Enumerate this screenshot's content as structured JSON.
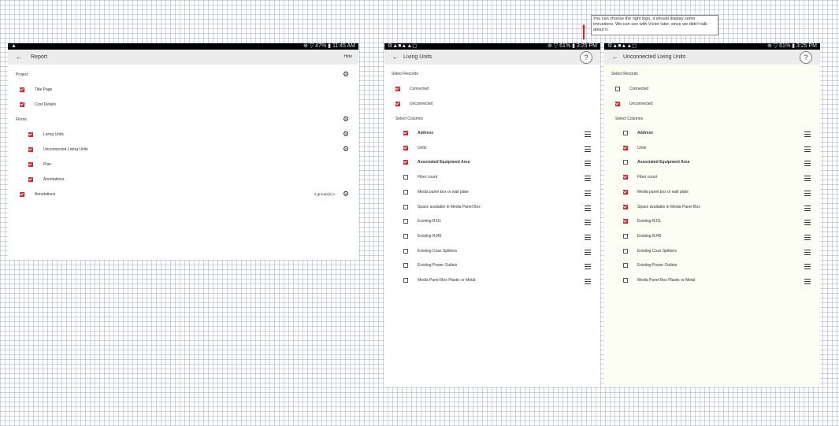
{
  "left_panel": {
    "status_time": "11:45 AM",
    "status_icons": "⊕ ▽ 47% ▮",
    "title": "Report",
    "action": "Hide",
    "items": [
      {
        "label": "Project",
        "checked": null,
        "gear": true
      },
      {
        "label": "Title Page",
        "checked": true,
        "gear": false
      },
      {
        "label": "Cost Details",
        "checked": true,
        "gear": false
      },
      {
        "label": "Floors",
        "checked": null,
        "gear": true
      },
      {
        "label": "Living Units",
        "checked": true,
        "gear": true
      },
      {
        "label": "Unconnected Living Units",
        "checked": true,
        "gear": true
      },
      {
        "label": "Plan",
        "checked": true,
        "gear": false
      },
      {
        "label": "Annotations",
        "checked": true,
        "gear": false
      },
      {
        "label": "Annotations",
        "checked": true,
        "gear": true,
        "extra": "3 groups(s) ▷"
      }
    ]
  },
  "middle_panel": {
    "status_time": "3:25 PM",
    "status_left": "⚙▲■▲▲◻",
    "status_icons": "⊕ ▽ 61% ▮",
    "title": "Living Units",
    "help": "?",
    "select_records_label": "Select Records",
    "records": [
      {
        "label": "Connected",
        "checked": true
      },
      {
        "label": "Unconnected",
        "checked": true
      }
    ],
    "select_columns_label": "Select Columns",
    "columns": [
      {
        "label": "Address",
        "checked": true,
        "bold": true
      },
      {
        "label": "Units",
        "checked": true,
        "bold": false
      },
      {
        "label": "Associated Equipment Area",
        "checked": true,
        "bold": true
      },
      {
        "label": "Fiber count",
        "checked": false,
        "bold": false
      },
      {
        "label": "Media panel box or wall plate",
        "checked": false,
        "bold": false
      },
      {
        "label": "Space available in Media Panel Box",
        "checked": false,
        "bold": false
      },
      {
        "label": "Existing RJ11",
        "checked": false,
        "bold": false
      },
      {
        "label": "Existing RJ45",
        "checked": false,
        "bold": false
      },
      {
        "label": "Existing Coax Splitters",
        "checked": false,
        "bold": false
      },
      {
        "label": "Existing Power Outlets",
        "checked": false,
        "bold": false
      },
      {
        "label": "Media Panel Box Plastic or Metal",
        "checked": false,
        "bold": false
      }
    ]
  },
  "right_panel": {
    "status_time": "3:25 PM",
    "status_left": "⚙▲■▲▲◻",
    "status_icons": "⊕ ▽ 61% ▮",
    "title": "Unconnected Living Units",
    "help": "?",
    "select_records_label": "Select Records",
    "records": [
      {
        "label": "Connected",
        "checked": false
      },
      {
        "label": "Unconnected",
        "checked": true
      }
    ],
    "select_columns_label": "Select Columns",
    "columns": [
      {
        "label": "Address",
        "checked": false,
        "bold": true
      },
      {
        "label": "Units",
        "checked": true,
        "bold": false
      },
      {
        "label": "Associated Equipment Area",
        "checked": false,
        "bold": true
      },
      {
        "label": "Fiber count",
        "checked": true,
        "bold": false
      },
      {
        "label": "Media panel box or wall plate",
        "checked": true,
        "bold": false
      },
      {
        "label": "Space available in Media Panel Box",
        "checked": true,
        "bold": false
      },
      {
        "label": "Existing RJ11",
        "checked": true,
        "bold": false
      },
      {
        "label": "Existing RJ45",
        "checked": false,
        "bold": false
      },
      {
        "label": "Existing Coax Splitters",
        "checked": false,
        "bold": false
      },
      {
        "label": "Existing Power Outlets",
        "checked": false,
        "bold": false
      },
      {
        "label": "Media Panel Box Plastic or Metal",
        "checked": false,
        "bold": false
      }
    ]
  },
  "annotation_note": "You can choose the right logo, it should display some intructions. We can see with Victor later, since we didn't talk about it.",
  "colors": {
    "accent": "#d9232e",
    "appbar": "#ececec"
  }
}
